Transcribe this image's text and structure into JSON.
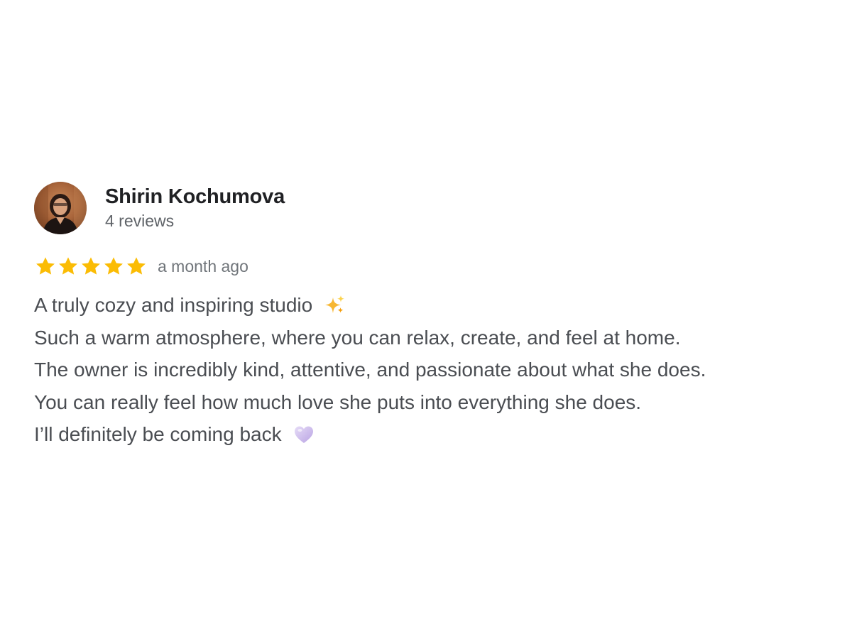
{
  "review": {
    "author": {
      "name": "Shirin Kochumova",
      "meta": "4 reviews",
      "avatar": "profile-photo"
    },
    "rating": {
      "stars": 5,
      "max": 5,
      "star_color": "#fbbc04",
      "time": "a month ago"
    },
    "text": {
      "line1": "A truly cozy and inspiring studio",
      "line1_emoji": "sparkles-emoji",
      "line2": "Such a warm atmosphere, where you can relax, create, and feel at home.",
      "line3": "The owner is incredibly kind, attentive, and passionate about what she does.",
      "line4": "You can really feel how much love she puts into everything she does.",
      "line5": "I’ll definitely be coming back",
      "line5_emoji": "purple-heart-emoji"
    }
  },
  "colors": {
    "name": "#202124",
    "meta": "#5f6368",
    "body": "#4a4d52",
    "background": "#ffffff"
  }
}
